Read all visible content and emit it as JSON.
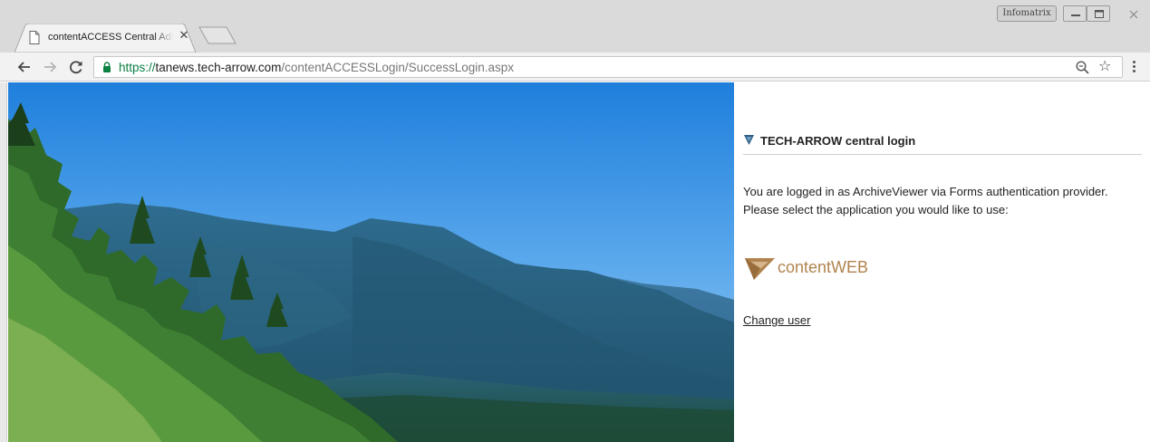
{
  "browser": {
    "tab": {
      "title": "contentACCESS Central Adi",
      "close_glyph": "✕",
      "icon": "page-icon"
    },
    "profile_label": "Infomatrix",
    "window_controls": [
      "minimize-icon",
      "maximize-icon",
      "close-icon"
    ],
    "nav": {
      "back": "arrow-left-icon",
      "forward": "arrow-right-icon",
      "reload": "reload-icon"
    },
    "address": {
      "scheme": "https://",
      "host": "tanews.tech-arrow.com",
      "path": "/contentACCESSLogin/SuccessLogin.aspx",
      "scheme_color": "#0b8043"
    },
    "star_glyph": "☆"
  },
  "page": {
    "hero_image": "mountain-forest-landscape",
    "login": {
      "heading": "TECH-ARROW central login",
      "message": "You are logged in as ArchiveViewer via Forms authentication provider. Please select the application you would like to use:",
      "apps": [
        {
          "label": "contentWEB",
          "color": "#b1844f"
        }
      ],
      "change_user": "Change user"
    }
  }
}
